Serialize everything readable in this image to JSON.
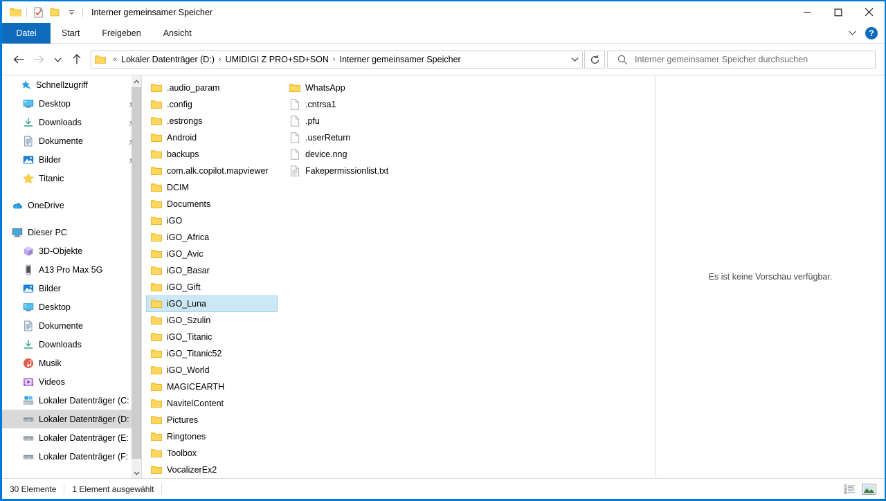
{
  "window": {
    "title": "Interner gemeinsamer Speicher",
    "minimize_label": "Minimieren",
    "maximize_label": "Maximieren",
    "close_label": "Schließen"
  },
  "quick_access_toolbar": {
    "items": [
      {
        "icon": "folder-icon",
        "label": "Eigenschaften"
      },
      {
        "icon": "properties-check-icon",
        "label": "Eigenschaften"
      },
      {
        "icon": "new-folder-icon",
        "label": "Neuer Ordner"
      },
      {
        "icon": "chevron-down-icon",
        "label": "Symbolleiste für den Schnellzugriff anpassen"
      }
    ]
  },
  "ribbon": {
    "tabs": [
      {
        "label": "Datei",
        "active": true
      },
      {
        "label": "Start",
        "active": false
      },
      {
        "label": "Freigeben",
        "active": false
      },
      {
        "label": "Ansicht",
        "active": false
      }
    ],
    "collapse_icon": "chevron-down-icon",
    "help_label": "?"
  },
  "navigation": {
    "back_label": "Zurück",
    "forward_label": "Vorwärts",
    "recent_label": "Zuletzt besuchte Speicherorte",
    "up_label": "Eine Ebene nach oben",
    "refresh_label": "Aktualisieren",
    "address_dropdown_label": "Vorherige Speicherorte"
  },
  "breadcrumb": {
    "prefix": "«",
    "items": [
      "Lokaler Datenträger (D:)",
      "UMIDIGI Z PRO+SD+SON",
      "Interner gemeinsamer Speicher"
    ],
    "separator": "›"
  },
  "search": {
    "placeholder": "Interner gemeinsamer Speicher durchsuchen",
    "value": "",
    "icon": "search-icon"
  },
  "sidebar": {
    "groups": [
      {
        "header": {
          "label": "Schnellzugriff",
          "icon": "star-pin-icon",
          "indent": 1
        },
        "items": [
          {
            "label": "Desktop",
            "icon": "desktop-icon",
            "pinned": true
          },
          {
            "label": "Downloads",
            "icon": "downloads-icon",
            "pinned": true
          },
          {
            "label": "Dokumente",
            "icon": "documents-icon",
            "pinned": true
          },
          {
            "label": "Bilder",
            "icon": "pictures-icon",
            "pinned": true
          },
          {
            "label": "Titanic",
            "icon": "star-folder-icon",
            "pinned": false
          }
        ]
      },
      {
        "header": {
          "label": "OneDrive",
          "icon": "onedrive-cloud-icon",
          "indent": 0
        },
        "items": []
      },
      {
        "header": {
          "label": "Dieser PC",
          "icon": "this-pc-icon",
          "indent": 0
        },
        "items": [
          {
            "label": "3D-Objekte",
            "icon": "3d-objects-icon",
            "pinned": false
          },
          {
            "label": "A13 Pro Max 5G",
            "icon": "phone-icon",
            "pinned": false
          },
          {
            "label": "Bilder",
            "icon": "pictures-icon",
            "pinned": false
          },
          {
            "label": "Desktop",
            "icon": "desktop-icon",
            "pinned": false
          },
          {
            "label": "Dokumente",
            "icon": "documents-icon",
            "pinned": false
          },
          {
            "label": "Downloads",
            "icon": "downloads-icon",
            "pinned": false
          },
          {
            "label": "Musik",
            "icon": "music-icon",
            "pinned": false
          },
          {
            "label": "Videos",
            "icon": "videos-icon",
            "pinned": false
          },
          {
            "label": "Lokaler Datenträger (C:",
            "icon": "windows-drive-icon",
            "pinned": false
          },
          {
            "label": "Lokaler Datenträger (D:",
            "icon": "drive-icon",
            "pinned": false,
            "selected": true
          },
          {
            "label": "Lokaler Datenträger (E:",
            "icon": "drive-icon",
            "pinned": false
          },
          {
            "label": "Lokaler Datenträger (F:",
            "icon": "drive-icon",
            "pinned": false
          }
        ]
      }
    ],
    "scroll_up_icon": "chevron-up-icon",
    "scroll_down_icon": "chevron-down-icon"
  },
  "file_list": {
    "column1": [
      {
        "name": ".audio_param",
        "type": "folder"
      },
      {
        "name": ".config",
        "type": "folder"
      },
      {
        "name": ".estrongs",
        "type": "folder"
      },
      {
        "name": "Android",
        "type": "folder"
      },
      {
        "name": "backups",
        "type": "folder"
      },
      {
        "name": "com.alk.copilot.mapviewer",
        "type": "folder"
      },
      {
        "name": "DCIM",
        "type": "folder"
      },
      {
        "name": "Documents",
        "type": "folder"
      },
      {
        "name": "iGO",
        "type": "folder"
      },
      {
        "name": "iGO_Africa",
        "type": "folder"
      },
      {
        "name": "iGO_Avic",
        "type": "folder"
      },
      {
        "name": "iGO_Basar",
        "type": "folder"
      },
      {
        "name": "iGO_Gift",
        "type": "folder"
      },
      {
        "name": "iGO_Luna",
        "type": "folder",
        "selected": true
      },
      {
        "name": "iGO_Szulin",
        "type": "folder"
      },
      {
        "name": "iGO_Titanic",
        "type": "folder"
      },
      {
        "name": "iGO_Titanic52",
        "type": "folder"
      },
      {
        "name": "iGO_World",
        "type": "folder"
      },
      {
        "name": "MAGICEARTH",
        "type": "folder"
      },
      {
        "name": "NavitelContent",
        "type": "folder"
      },
      {
        "name": "Pictures",
        "type": "folder"
      },
      {
        "name": "Ringtones",
        "type": "folder"
      },
      {
        "name": "Toolbox",
        "type": "folder"
      },
      {
        "name": "VocalizerEx2",
        "type": "folder"
      }
    ],
    "column2": [
      {
        "name": "WhatsApp",
        "type": "folder"
      },
      {
        "name": ".cntrsa1",
        "type": "file"
      },
      {
        "name": ".pfu",
        "type": "file"
      },
      {
        "name": ".userReturn",
        "type": "file"
      },
      {
        "name": "device.nng",
        "type": "file"
      },
      {
        "name": "Fakepermissionlist.txt",
        "type": "textfile"
      }
    ]
  },
  "preview": {
    "message": "Es ist keine Vorschau verfügbar."
  },
  "status": {
    "item_count": "30 Elemente",
    "selection": "1 Element ausgewählt",
    "view_details_label": "Details anzeigen",
    "view_large_icons_label": "Große Symbole anzeigen"
  },
  "colors": {
    "accent": "#0078d7",
    "file_tab": "#0f6cbd",
    "selection": "#cce8f4",
    "selection_border": "#9fd4ea",
    "folder_yellow": "#ffd34d",
    "nav_selected": "#d9d9d9"
  }
}
